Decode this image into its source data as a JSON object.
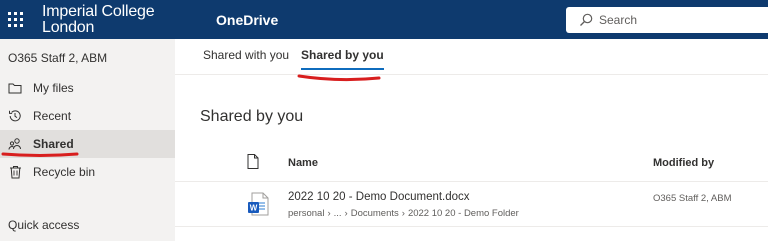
{
  "header": {
    "logo_line1": "Imperial College",
    "logo_line2": "London",
    "app_name": "OneDrive",
    "search_placeholder": "Search",
    "background_color": "#0e3a6e"
  },
  "sidebar": {
    "account": "O365 Staff 2, ABM",
    "items": [
      {
        "label": "My files",
        "icon": "folder-icon",
        "selected": false
      },
      {
        "label": "Recent",
        "icon": "history-icon",
        "selected": false
      },
      {
        "label": "Shared",
        "icon": "people-icon",
        "selected": true
      },
      {
        "label": "Recycle bin",
        "icon": "trash-icon",
        "selected": false
      }
    ],
    "quick_access": "Quick access"
  },
  "tabs": [
    {
      "label": "Shared with you",
      "active": false
    },
    {
      "label": "Shared by you",
      "active": true
    }
  ],
  "main": {
    "title": "Shared by you",
    "columns": {
      "name": "Name",
      "modified_by": "Modified by"
    },
    "files": [
      {
        "name": "2022 10 20 - Demo Document.docx",
        "path": [
          "personal",
          "...",
          "Documents",
          "2022 10 20 - Demo Folder"
        ],
        "modified_by": "O365 Staff 2, ABM",
        "icon": "word-document-icon"
      }
    ]
  },
  "colors": {
    "accent": "#0f6cbd",
    "annotation_red": "#d81e1e",
    "nav_background": "#f3f2f1",
    "nav_selected": "#e1dfdd"
  }
}
